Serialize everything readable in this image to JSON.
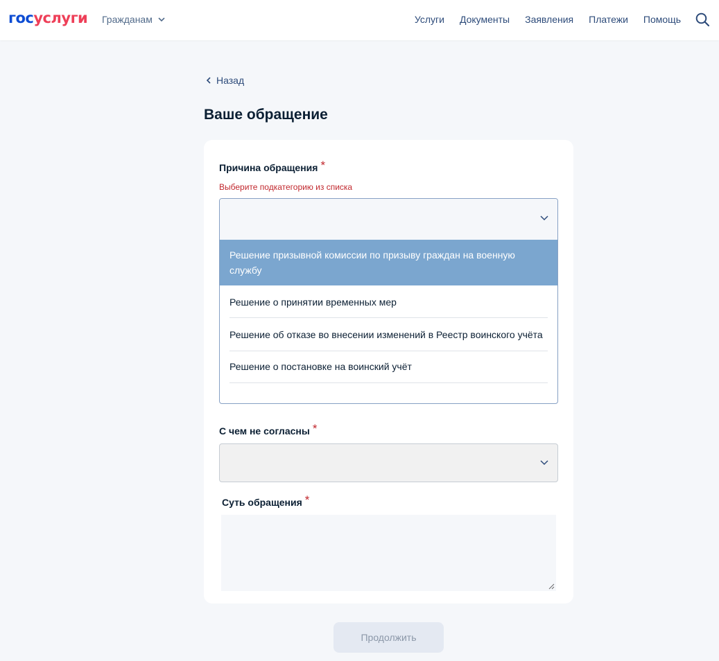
{
  "header": {
    "logo_part1": "гос",
    "logo_part2": "услуги",
    "audience_label": "Гражданам",
    "nav": [
      "Услуги",
      "Документы",
      "Заявления",
      "Платежи",
      "Помощь"
    ],
    "icons": {
      "search": "search-icon",
      "audience_chevron": "chevron-down-icon"
    }
  },
  "back_label": "Назад",
  "page_title": "Ваше обращение",
  "form": {
    "reason": {
      "label": "Причина обращения",
      "required_mark": "*",
      "error": "Выберите подкатегорию из списка",
      "value": "",
      "options": [
        "Решение призывной комиссии по призыву граждан на военную службу",
        "Решение о принятии временных мер",
        "Решение об отказе во внесении изменений в Реестр воинского учёта",
        "Решение о постановке на воинский учёт"
      ],
      "highlighted_index": 0
    },
    "disagree": {
      "label": "С чем не согласны",
      "required_mark": "*",
      "value": ""
    },
    "essence": {
      "label": "Суть обращения",
      "required_mark": "*",
      "value": ""
    }
  },
  "continue_label": "Продолжить",
  "colors": {
    "brand_blue": "#0d4cd3",
    "brand_red": "#ee3f58",
    "error": "#c1272d",
    "option_highlight": "#7ba6cf",
    "link": "#2d4b7a"
  }
}
